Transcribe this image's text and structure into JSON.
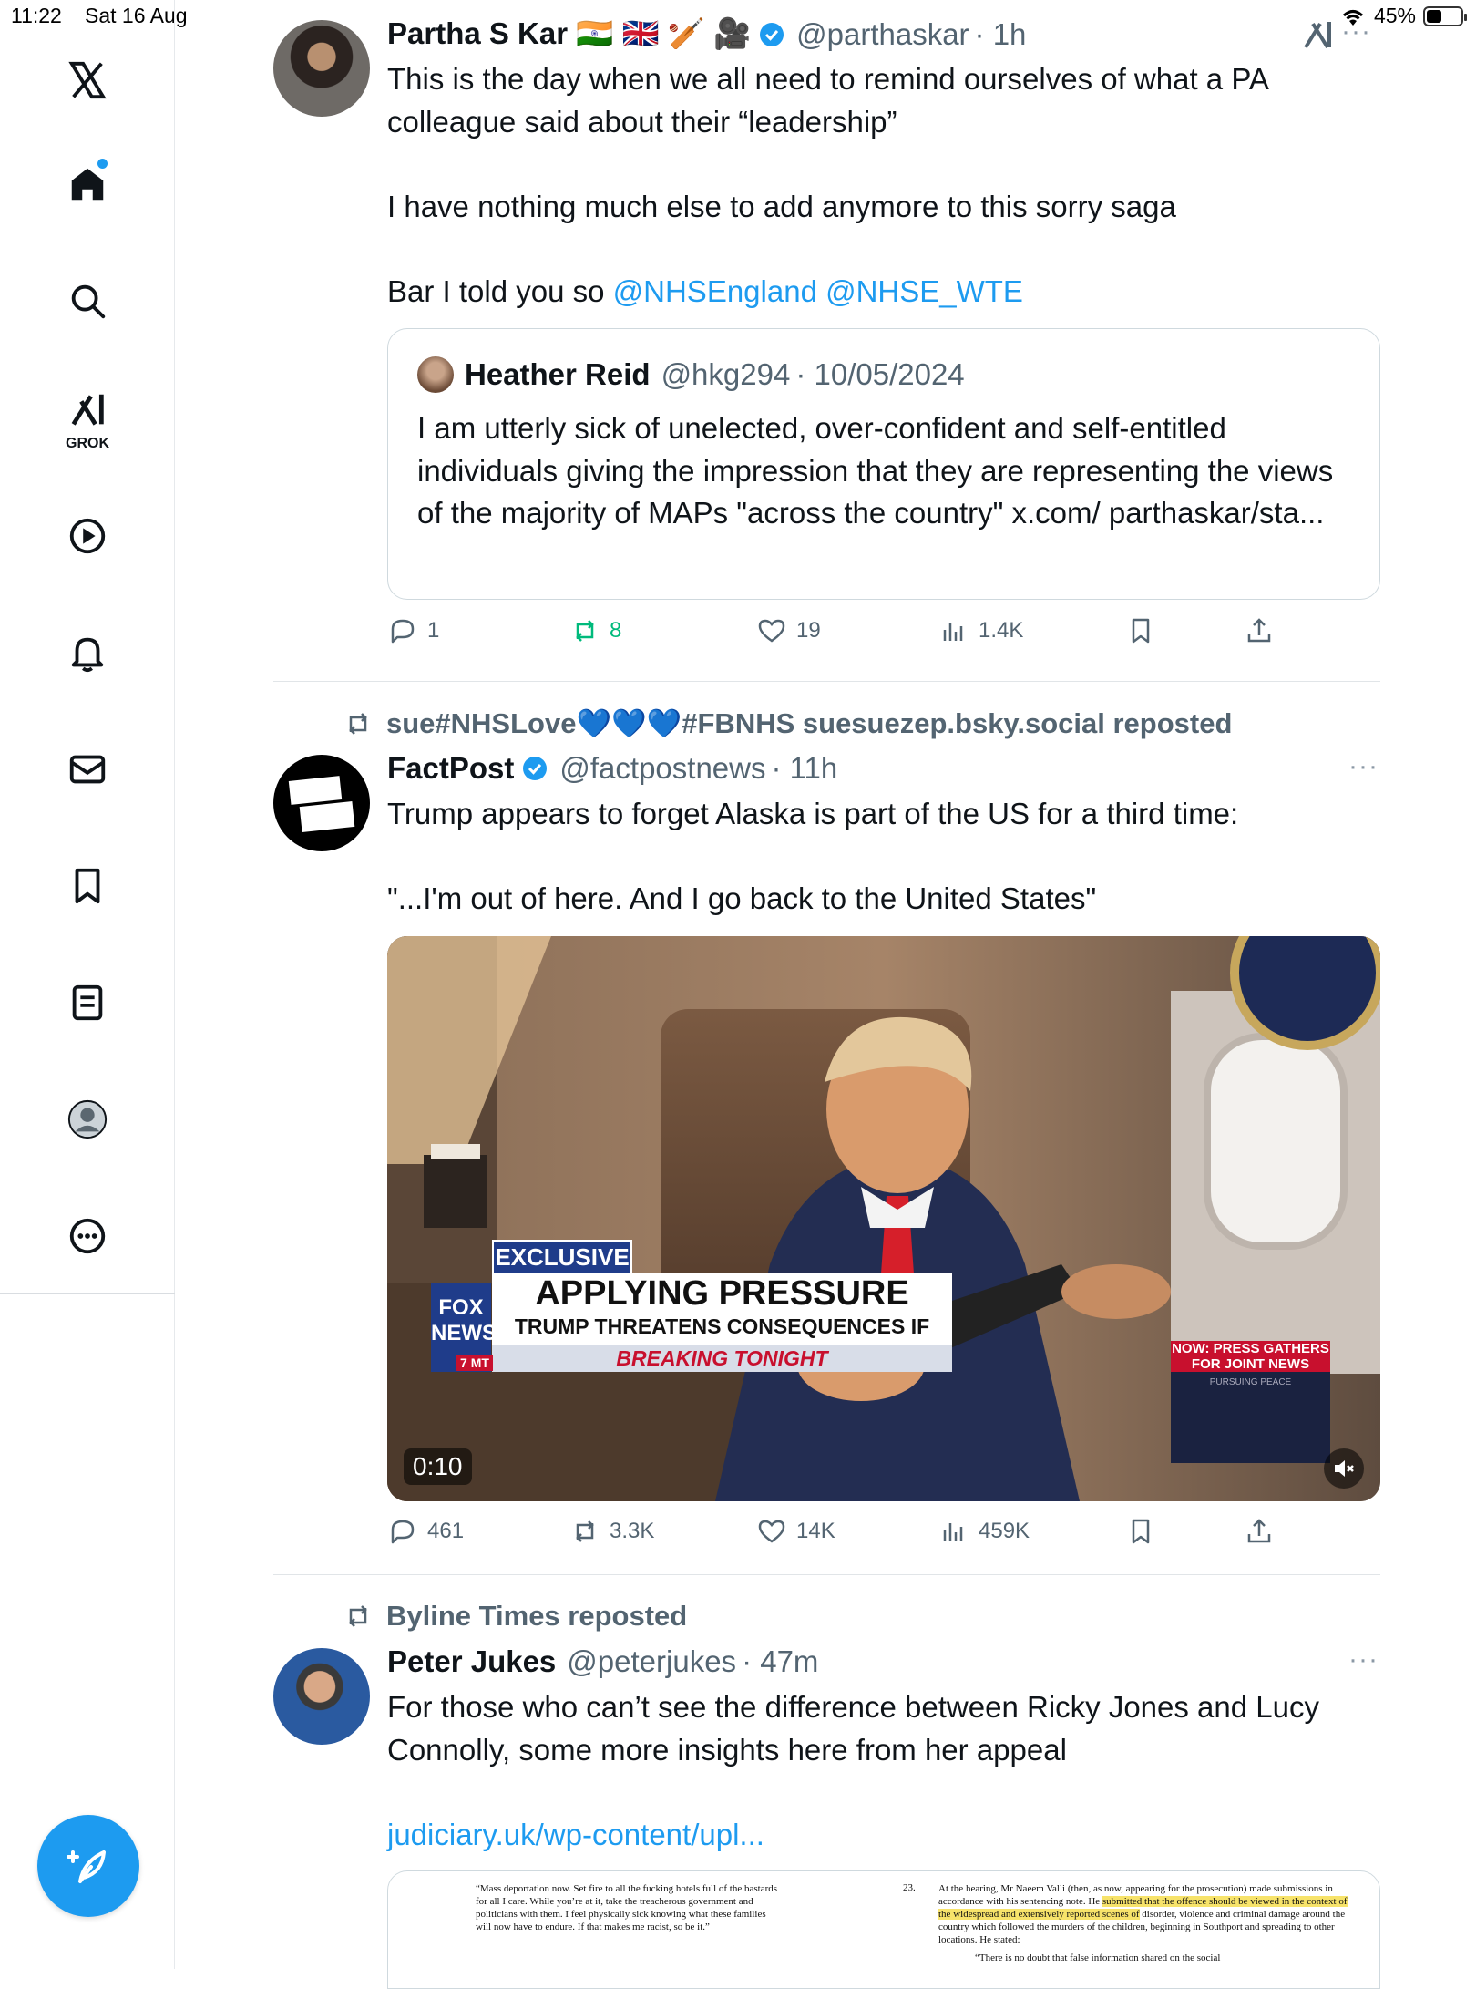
{
  "status_bar": {
    "time": "11:22",
    "date": "Sat 16 Aug",
    "battery": "45%",
    "battery_level": 0.45
  },
  "sidebar": {
    "items": [
      {
        "label": "Home",
        "icon": "home-icon"
      },
      {
        "label": "Search",
        "icon": "search-icon"
      },
      {
        "label": "GROK",
        "icon": "grok-icon"
      },
      {
        "label": "Videos",
        "icon": "play-icon"
      },
      {
        "label": "Notifications",
        "icon": "bell-icon"
      },
      {
        "label": "Messages",
        "icon": "mail-icon"
      },
      {
        "label": "Bookmarks",
        "icon": "bookmark-icon"
      },
      {
        "label": "Lists",
        "icon": "list-icon"
      },
      {
        "label": "Profile",
        "icon": "profile-icon"
      },
      {
        "label": "More",
        "icon": "more-icon"
      }
    ],
    "grok_label": "GROK"
  },
  "posts": [
    {
      "name": "Partha S Kar 🇮🇳 🇬🇧 🏏 🎥",
      "handle": "@parthaskar",
      "time": "· 1h",
      "lines": [
        "This is the day when we all need to remind ourselves of what a PA colleague said about their “leadership”",
        "I have nothing much else to add anymore to this sorry saga",
        "Bar I told you so"
      ],
      "mentions": [
        "@NHSEngland",
        "@NHSE_WTE"
      ],
      "quote": {
        "name": "Heather Reid",
        "handle": "@hkg294",
        "time": "· 10/05/2024",
        "text": "I am utterly sick of unelected, over-confident and self-entitled individuals giving the impression that they are representing the views of the majority of MAPs \"across the country\" x.com/ parthaskar/sta..."
      },
      "stats": {
        "replies": "1",
        "reposts": "8",
        "likes": "19",
        "views": "1.4K"
      }
    },
    {
      "repost_by": "sue#NHSLove💙💙💙#FBNHS suesuezep.bsky.social reposted",
      "name": "FactPost",
      "handle": "@factpostnews",
      "time": "· 11h",
      "lines": [
        "Trump appears to forget Alaska is part of the US for a third time:",
        "\"...I'm out of here. And I go back to the United States\""
      ],
      "video": {
        "duration": "0:10",
        "exclusive": "EXCLUSIVE",
        "headline": "APPLYING PRESSURE",
        "subhead": "TRUMP THREATENS CONSEQUENCES IF TALKS FAIL",
        "breaking": "BREAKING TONIGHT",
        "network": "FOX NEWS",
        "tz": "7 MT",
        "side_title": "NOW: PRESS GATHERS FOR JOINT NEWS CONFERENCE",
        "side_small": "PURSUING PEACE"
      },
      "stats": {
        "replies": "461",
        "reposts": "3.3K",
        "likes": "14K",
        "views": "459K"
      }
    },
    {
      "repost_by": "Byline Times reposted",
      "name": "Peter Jukes",
      "handle": "@peterjukes",
      "time": "· 47m",
      "lines": [
        "For those who can’t see the difference between Ricky Jones and Lucy Connolly, some more insights here from her appeal"
      ],
      "link": "judiciary.uk/wp-content/upl...",
      "doc": {
        "left": "“Mass deportation now. Set fire to all the fucking hotels full of the bastards for all I care. While you’re at it, take the treacherous government and politicians with them. I feel physically sick knowing what these families will now have to endure. If that makes me racist, so be it.”",
        "num": "23.",
        "right_a": "At the hearing, Mr Naeem Valli (then, as now, appearing for the prosecution) made submissions in accordance with his sentencing note. He",
        "right_hl": "submitted that the offence should be viewed in the context of the widespread and extensively reported scenes of",
        "right_b": "disorder, violence and criminal damage around the country which followed the murders of the children, beginning in Southport and spreading to other locations. He stated:",
        "right_c": "“There is no doubt that false information shared on the social"
      }
    }
  ],
  "colors": {
    "accent": "#1d9bf0",
    "repost_green": "#00ba7c",
    "muted": "#536471"
  }
}
